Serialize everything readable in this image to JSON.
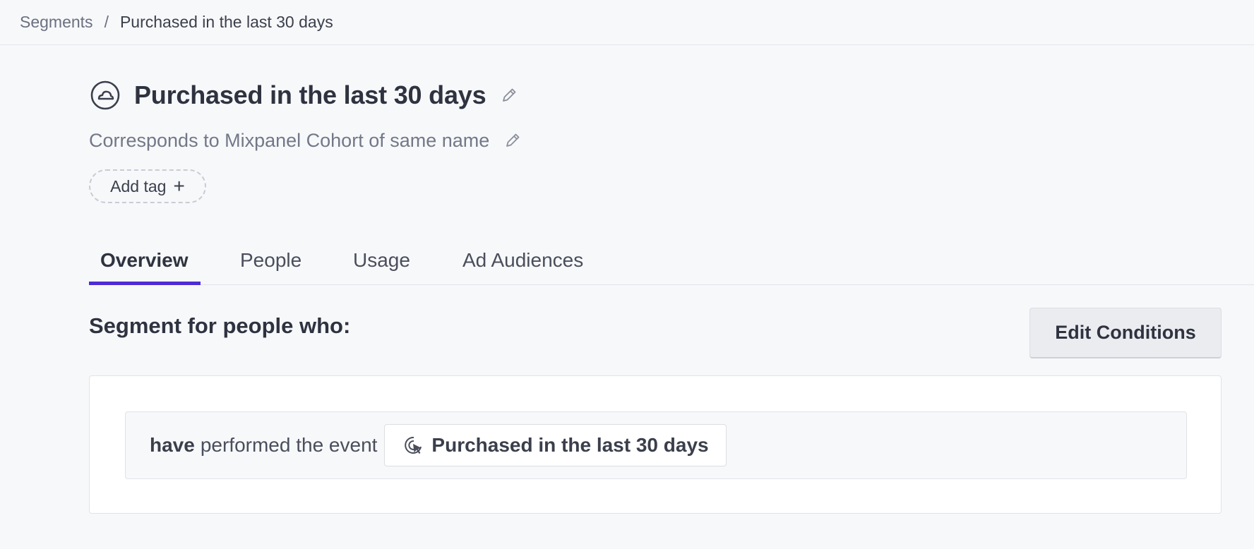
{
  "breadcrumb": {
    "parent": "Segments",
    "separator": "/",
    "current": "Purchased in the last 30 days"
  },
  "segment": {
    "title": "Purchased in the last 30 days",
    "description": "Corresponds to Mixpanel Cohort of same name",
    "add_tag_label": "Add tag",
    "add_tag_plus": "+",
    "icon": "segment-cloud-icon"
  },
  "tabs": [
    {
      "label": "Overview",
      "active": true
    },
    {
      "label": "People",
      "active": false
    },
    {
      "label": "Usage",
      "active": false
    },
    {
      "label": "Ad Audiences",
      "active": false
    }
  ],
  "conditions": {
    "heading": "Segment for people who:",
    "edit_label": "Edit Conditions",
    "rule": {
      "qualifier": "have",
      "verb": "performed the event",
      "event_name": "Purchased in the last 30 days",
      "event_icon": "event-cursor-icon"
    }
  },
  "colors": {
    "accent": "#4f2bd6",
    "background": "#f7f8fa",
    "text": "#2f3340",
    "muted": "#737888"
  }
}
